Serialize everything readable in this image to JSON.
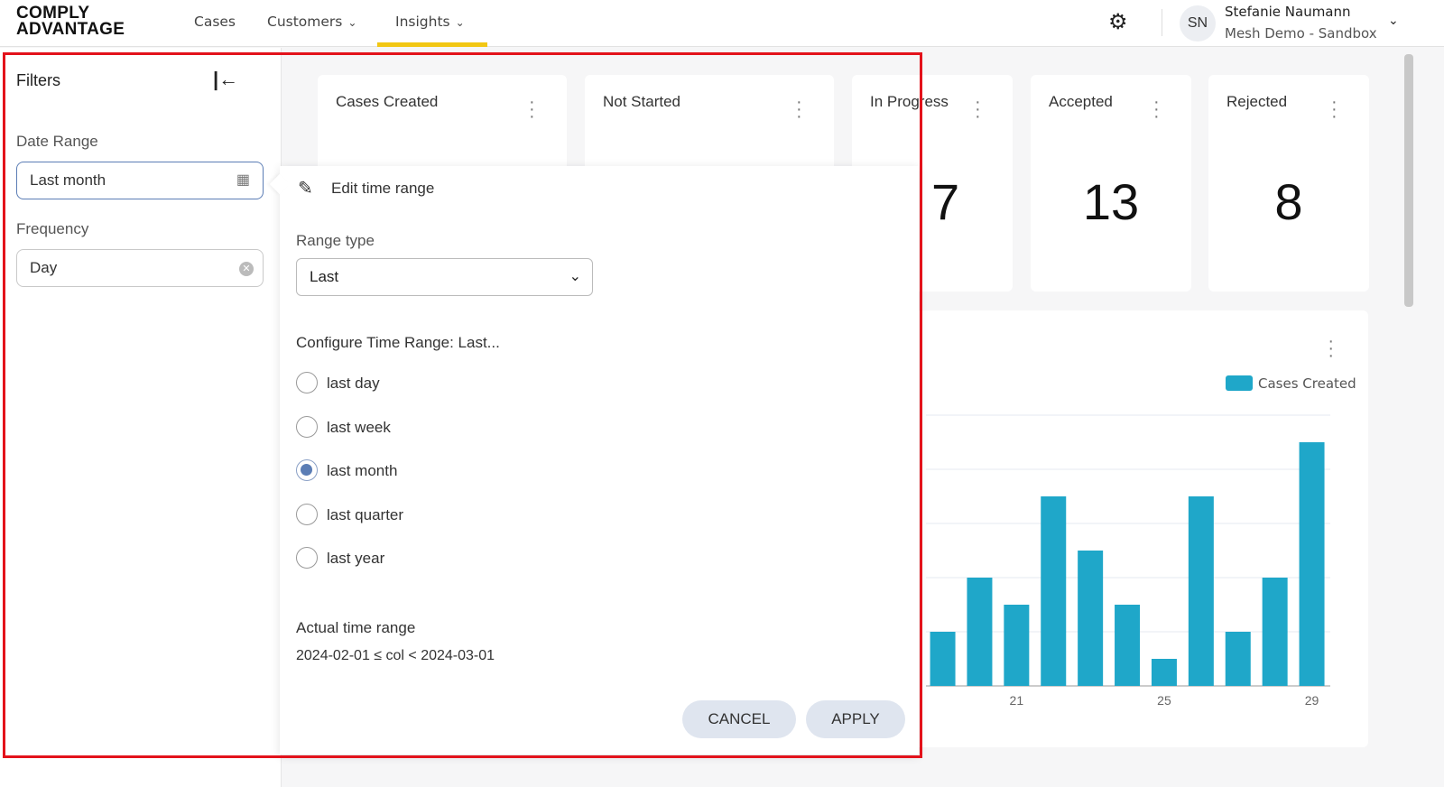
{
  "header": {
    "logo_line1": "COMPLY",
    "logo_line2": "ADVANTAGE",
    "nav": [
      {
        "label": "Cases"
      },
      {
        "label": "Customers",
        "chevron": "▾"
      },
      {
        "label": "Insights",
        "chevron": "▾"
      }
    ],
    "avatar": "SN",
    "user_name": "Stefanie Naumann",
    "user_org": "Mesh Demo - Sandbox"
  },
  "filters": {
    "title": "Filters",
    "date_range_label": "Date Range",
    "date_range_value": "Last month",
    "frequency_label": "Frequency",
    "frequency_value": "Day"
  },
  "cards": [
    {
      "title": "Cases Created",
      "value": ""
    },
    {
      "title": "Not Started",
      "value": ""
    },
    {
      "title": "In Progress",
      "value": "7"
    },
    {
      "title": "Accepted",
      "value": "13"
    },
    {
      "title": "Rejected",
      "value": "8"
    }
  ],
  "popover": {
    "title": "Edit time range",
    "range_type_label": "Range type",
    "range_type_value": "Last",
    "configure_label": "Configure Time Range: Last...",
    "options": [
      "last day",
      "last week",
      "last month",
      "last quarter",
      "last year"
    ],
    "selected": "last month",
    "actual_label": "Actual time range",
    "actual_value": "2024-02-01 ≤ col < 2024-03-01",
    "cancel": "CANCEL",
    "apply": "APPLY"
  },
  "chart_data": {
    "type": "bar",
    "legend": "Cases Created",
    "legend_position": "top-right",
    "color": "#1fa7c9",
    "x": [
      19,
      20,
      21,
      22,
      23,
      24,
      25,
      26,
      27,
      28,
      29
    ],
    "values": [
      2,
      4,
      3,
      7,
      5,
      3,
      1,
      7,
      2,
      4,
      9
    ],
    "xticks": [
      "21",
      "25",
      "29"
    ],
    "ylim": [
      0,
      10
    ]
  }
}
